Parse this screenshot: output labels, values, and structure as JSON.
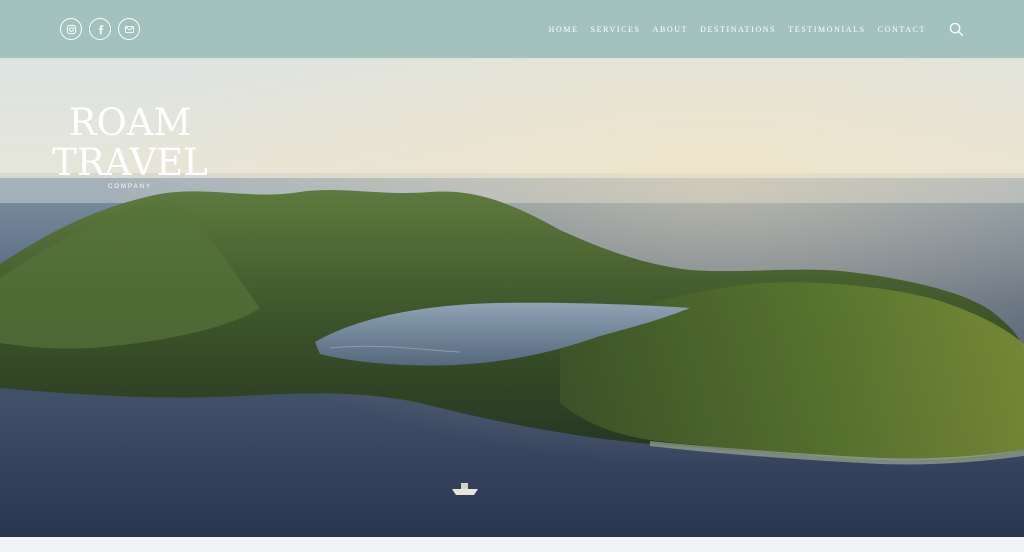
{
  "header": {
    "socials": [
      {
        "icon": "instagram-icon"
      },
      {
        "icon": "facebook-icon"
      },
      {
        "icon": "email-icon"
      }
    ],
    "nav": [
      "HOME",
      "SERVICES",
      "ABOUT",
      "DESTINATIONS",
      "TESTIMONIALS",
      "CONTACT"
    ],
    "search_icon": "search-icon",
    "background": "#a3c1bd"
  },
  "hero": {
    "logo": {
      "line1": "ROAM",
      "line2": "TRAVEL",
      "sub": "COMPANY"
    }
  }
}
